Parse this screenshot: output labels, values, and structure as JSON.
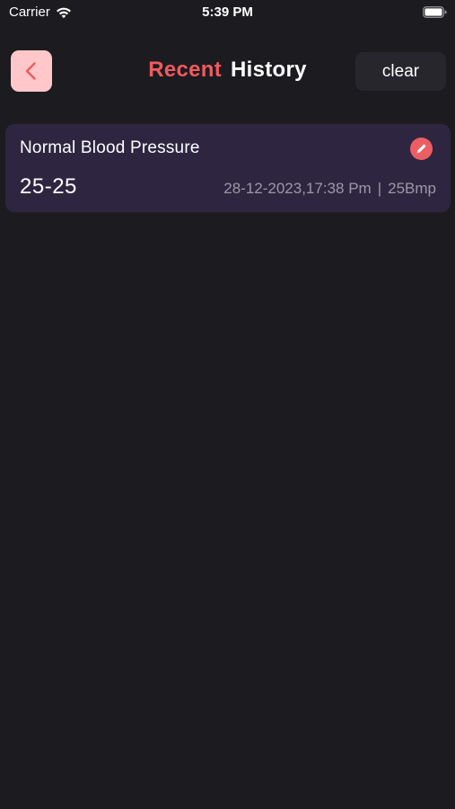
{
  "status_bar": {
    "carrier": "Carrier",
    "time": "5:39 PM"
  },
  "header": {
    "title_part1": "Recent",
    "title_part2": "History",
    "clear_label": "clear",
    "back_icon": "chevron-left-icon"
  },
  "records": [
    {
      "title": "Normal Blood Pressure",
      "value": "25-25",
      "datetime": "28-12-2023,17:38 Pm",
      "separator": "|",
      "pulse": "25Bmp",
      "edit_icon": "pencil-icon"
    }
  ],
  "colors": {
    "background": "#1c1b20",
    "accent": "#ee5b5f",
    "back_button_bg": "#ffc7c9",
    "card_bg": "#2e2641",
    "clear_button_bg": "#27262c",
    "meta_text": "#9c97a8"
  }
}
